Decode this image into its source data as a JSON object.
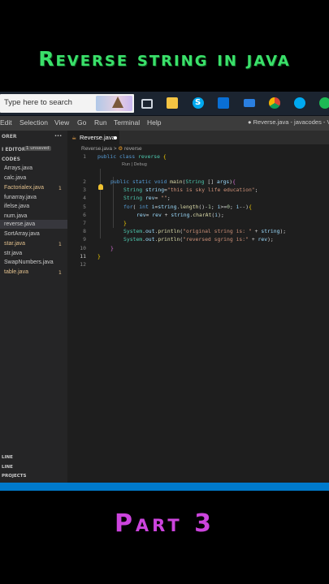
{
  "overlay": {
    "top_title": "Reverse string in java",
    "bottom_title": "Part 3"
  },
  "taskbar": {
    "search_placeholder": "Type here to search",
    "skype_label": "S"
  },
  "menu": {
    "items": [
      "Edit",
      "Selection",
      "View",
      "Go",
      "Run",
      "Terminal",
      "Help"
    ],
    "window_title": "● Reverse.java - javacodes - V"
  },
  "sidebar": {
    "explorer_label": "ORER",
    "open_editors_label": "I EDITORS",
    "unsaved_badge": "1 unsaved",
    "folder_label": "CODES",
    "files": [
      {
        "name": "Arrays.java",
        "count": ""
      },
      {
        "name": "calc.java",
        "count": ""
      },
      {
        "name": "Factorialex.java",
        "count": "1"
      },
      {
        "name": "funarray.java",
        "count": ""
      },
      {
        "name": "ifelse.java",
        "count": ""
      },
      {
        "name": "num.java",
        "count": ""
      },
      {
        "name": "reverse.java",
        "count": ""
      },
      {
        "name": "SortArray.java",
        "count": ""
      },
      {
        "name": "star.java",
        "count": "1"
      },
      {
        "name": "str.java",
        "count": ""
      },
      {
        "name": "SwapNumbers.java",
        "count": ""
      },
      {
        "name": "table.java",
        "count": "1"
      }
    ],
    "bottom": [
      "LINE",
      "LINE",
      "PROJECTS"
    ]
  },
  "editor": {
    "tab_label": "Reverse.java",
    "breadcrumb_file": "Reverse.java",
    "breadcrumb_sep": ">",
    "breadcrumb_class": "reverse",
    "codelens": "Run | Debug",
    "line_numbers": [
      "1",
      "2",
      "3",
      "4",
      "5",
      "6",
      "7",
      "8",
      "9",
      "10",
      "11",
      "12"
    ]
  }
}
